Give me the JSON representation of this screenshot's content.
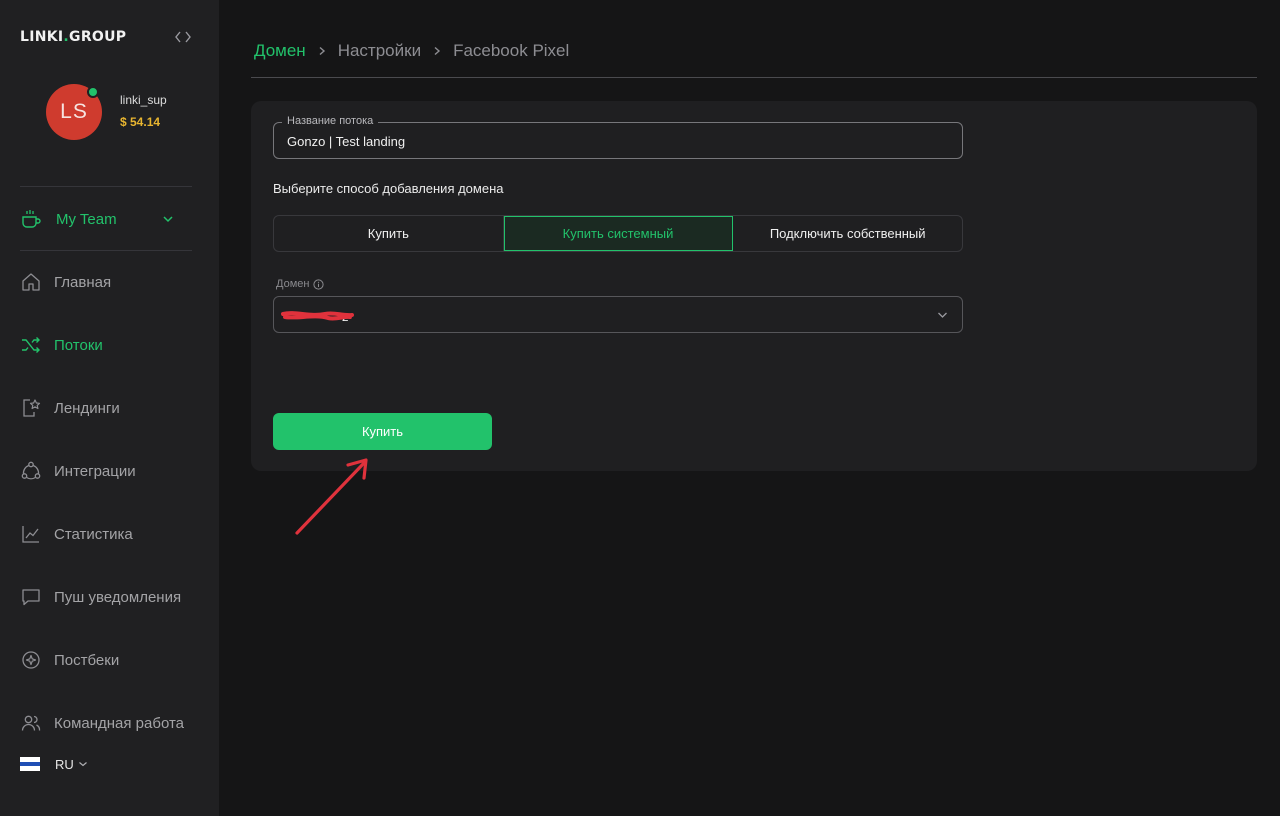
{
  "app": {
    "logo_main": "LINKI",
    "logo_accent": ".",
    "logo_suffix": "GROUP"
  },
  "user": {
    "initials": "LS",
    "username": "linki_sup",
    "balance": "$ 54.14",
    "online": true
  },
  "team": {
    "label": "My Team"
  },
  "nav": {
    "items": [
      {
        "label": "Главная",
        "icon": "home-icon",
        "active": false
      },
      {
        "label": "Потоки",
        "icon": "shuffle-icon",
        "active": true
      },
      {
        "label": "Лендинги",
        "icon": "landing-icon",
        "active": false
      },
      {
        "label": "Интеграции",
        "icon": "integrations-icon",
        "active": false
      },
      {
        "label": "Статистика",
        "icon": "chart-icon",
        "active": false
      },
      {
        "label": "Пуш уведомления",
        "icon": "chat-icon",
        "active": false
      },
      {
        "label": "Постбеки",
        "icon": "postback-icon",
        "active": false
      },
      {
        "label": "Командная работа",
        "icon": "team-icon",
        "active": false
      }
    ]
  },
  "language": {
    "code": "RU"
  },
  "breadcrumb": {
    "items": [
      "Домен",
      "Настройки",
      "Facebook Pixel"
    ]
  },
  "form": {
    "stream_name_label": "Название потока",
    "stream_name_value": "Gonzo | Test landing",
    "method_label": "Выберите способ добавления домена",
    "methods": [
      "Купить",
      "Купить системный",
      "Подключить собственный"
    ],
    "selected_method": "Купить системный",
    "domain_label": "Домен",
    "domain_value_visible": "z",
    "buy_button": "Купить"
  },
  "colors": {
    "accent": "#22c26b",
    "background": "#151516",
    "sidebar": "#202022",
    "card": "#1f1f21",
    "balance": "#e8b530",
    "avatar": "#cf3b2e",
    "annotation": "#e0323c"
  }
}
